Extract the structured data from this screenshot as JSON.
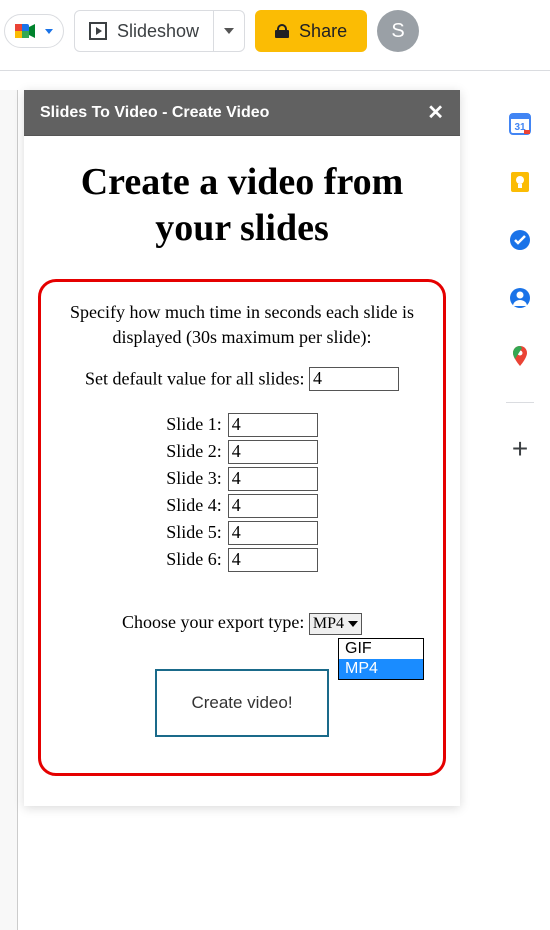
{
  "topbar": {
    "slideshow_label": "Slideshow",
    "share_label": "Share",
    "avatar_letter": "S"
  },
  "panel": {
    "title": "Slides To Video - Create Video",
    "heading": "Create a video from your slides",
    "instruction": "Specify how much time in seconds each slide is displayed (30s maximum per slide):",
    "default_label": "Set default value for all slides:",
    "default_value": "4",
    "slides": [
      {
        "label": "Slide 1:",
        "value": "4"
      },
      {
        "label": "Slide 2:",
        "value": "4"
      },
      {
        "label": "Slide 3:",
        "value": "4"
      },
      {
        "label": "Slide 4:",
        "value": "4"
      },
      {
        "label": "Slide 5:",
        "value": "4"
      },
      {
        "label": "Slide 6:",
        "value": "4"
      }
    ],
    "export_label": "Choose your export type:",
    "export_selected": "MP4",
    "export_options": [
      "GIF",
      "MP4"
    ],
    "create_label": "Create video!"
  },
  "rail": {
    "cal_day": "31"
  }
}
